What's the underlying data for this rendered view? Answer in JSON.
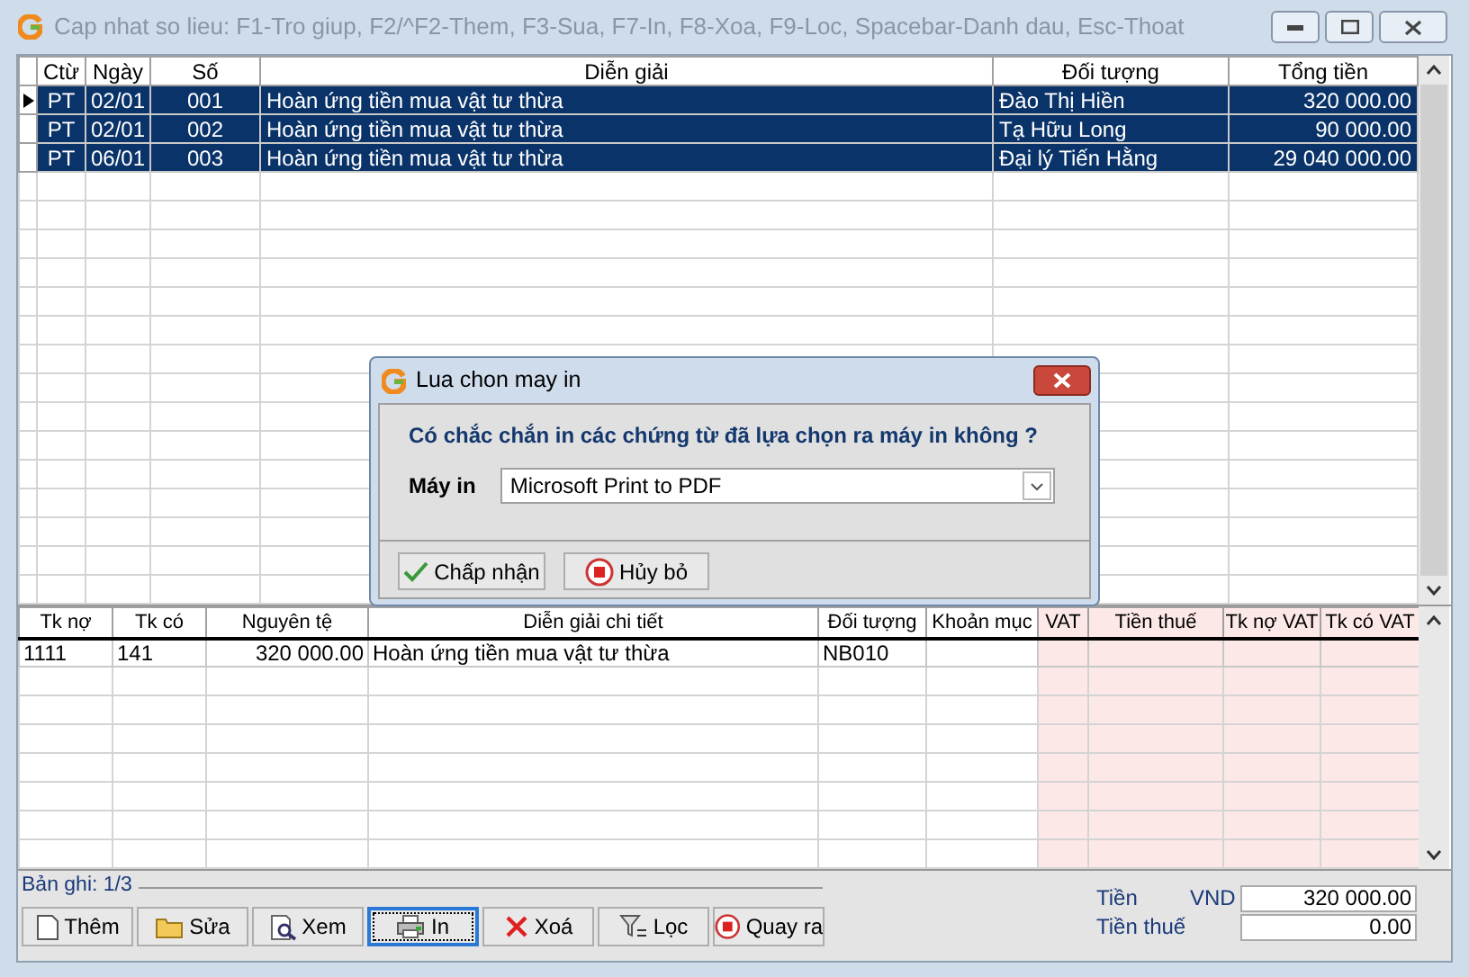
{
  "window": {
    "title": "Cap nhat so lieu: F1-Tro giup, F2/^F2-Them, F3-Sua, F7-In, F8-Xoa, F9-Loc, Spacebar-Danh dau, Esc-Thoat"
  },
  "voucher_table": {
    "columns": [
      "Ctừ",
      "Ngày",
      "Số",
      "Diễn giải",
      "Đối tượng",
      "Tổng tiền"
    ],
    "rows": [
      {
        "cells": [
          "PT",
          "02/01",
          "001",
          "Hoàn ứng tiền mua vật tư thừa",
          "Đào Thị Hiền",
          "320 000.00"
        ],
        "selected": true,
        "current": true
      },
      {
        "cells": [
          "PT",
          "02/01",
          "002",
          "Hoàn ứng tiền mua vật tư thừa",
          "Tạ Hữu Long",
          "90 000.00"
        ],
        "selected": true,
        "current": false
      },
      {
        "cells": [
          "PT",
          "06/01",
          "003",
          "Hoàn ứng tiền mua vật tư thừa",
          "Đại lý Tiến Hằng",
          "29 040 000.00"
        ],
        "selected": true,
        "current": false
      }
    ]
  },
  "detail_table": {
    "columns": [
      {
        "label": "Tk nợ",
        "tinted": false
      },
      {
        "label": "Tk có",
        "tinted": false
      },
      {
        "label": "Nguyên tệ",
        "tinted": false
      },
      {
        "label": "Diễn giải chi tiết",
        "tinted": false
      },
      {
        "label": "Đối tượng",
        "tinted": false
      },
      {
        "label": "Khoản mục",
        "tinted": false
      },
      {
        "label": "VAT",
        "tinted": true
      },
      {
        "label": "Tiền thuế",
        "tinted": true
      },
      {
        "label": "Tk nợ VAT",
        "tinted": true
      },
      {
        "label": "Tk có VAT",
        "tinted": true
      }
    ],
    "rows": [
      {
        "cells": [
          "1111",
          "141",
          "320 000.00",
          "Hoàn ứng tiền mua vật tư thừa",
          "NB010",
          "",
          "",
          "",
          "",
          ""
        ]
      }
    ]
  },
  "record_label": "Bản ghi: 1/3",
  "buttons": [
    {
      "label": "Thêm",
      "kind": "add",
      "focused": false
    },
    {
      "label": "Sửa",
      "kind": "edit",
      "focused": false
    },
    {
      "label": "Xem",
      "kind": "view",
      "focused": false
    },
    {
      "label": "In",
      "kind": "print",
      "focused": true
    },
    {
      "label": "Xoá",
      "kind": "delete",
      "focused": false
    },
    {
      "label": "Lọc",
      "kind": "filter",
      "focused": false
    },
    {
      "label": "Quay ra",
      "kind": "exit",
      "focused": false
    }
  ],
  "totals": [
    {
      "label": "Tiền",
      "currency": "VND",
      "value": "320 000.00"
    },
    {
      "label": "Tiền thuế",
      "value": "0.00"
    }
  ],
  "dialog": {
    "title": "Lua chon may in",
    "question": "Có chắc chắn in các chứng từ đã lựa chọn ra máy in không ?",
    "printer_label": "Máy in",
    "printer": "Microsoft Print to PDF",
    "buttons": [
      {
        "label": "Chấp nhận",
        "kind": "ok"
      },
      {
        "label": "Hủy bỏ",
        "kind": "cancel"
      }
    ]
  }
}
